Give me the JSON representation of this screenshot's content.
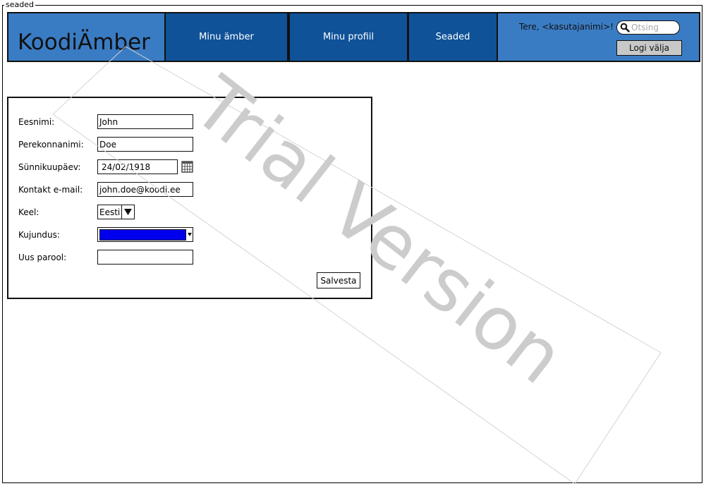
{
  "window": {
    "title": "seaded"
  },
  "header": {
    "logo": "KoodiÄmber",
    "nav": [
      "Minu ämber",
      "Minu profiil",
      "Seaded"
    ],
    "greeting": "Tere, <kasutajanimi>!",
    "search_placeholder": "Otsing",
    "logout_label": "Logi välja",
    "colors": {
      "bar": "#3a7cc4",
      "nav": "#0f5298"
    }
  },
  "form": {
    "first_name": {
      "label": "Eesnimi:",
      "value": "John"
    },
    "last_name": {
      "label": "Perekonnanimi:",
      "value": "Doe"
    },
    "birth_date": {
      "label": "Sünnikuupäev:",
      "value": "24/02/1918",
      "icon": "calendar-icon"
    },
    "email": {
      "label": "Kontakt e-mail:",
      "value": "john.doe@koodi.ee"
    },
    "language": {
      "label": "Keel:",
      "value": "Eesti"
    },
    "theme": {
      "label": "Kujundus:",
      "color": "#0000ee"
    },
    "new_password": {
      "label": "Uus parool:",
      "value": ""
    },
    "save_label": "Salvesta"
  },
  "watermark": {
    "text": "Trial Version",
    "color": "#cccccc"
  }
}
